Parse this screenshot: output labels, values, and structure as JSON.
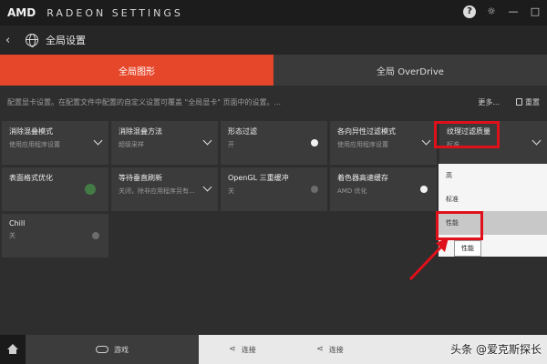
{
  "titlebar": {
    "brand": "AMD",
    "app_title": "RADEON SETTINGS",
    "help": "?",
    "settings": "☼",
    "minimize": "—",
    "maximize": "□"
  },
  "nav": {
    "back": "‹",
    "title": "全局设置"
  },
  "tabs": [
    {
      "label": "全局图形",
      "active": true
    },
    {
      "label": "全局 OverDrive",
      "active": false
    }
  ],
  "description": {
    "text": "配置显卡设置。在配置文件中配置的自定义设置可覆盖 \"全局显卡\" 页面中的设置。...",
    "more": "更多...",
    "reset": "重置"
  },
  "tiles": [
    {
      "label": "消除混叠模式",
      "value": "使用应用程序设置",
      "control": "chevron"
    },
    {
      "label": "消除混叠方法",
      "value": "超级采样",
      "control": "chevron"
    },
    {
      "label": "形态过滤",
      "value": "开",
      "control": "toggle-on"
    },
    {
      "label": "各向异性过滤模式",
      "value": "使用应用程序设置",
      "control": "chevron"
    },
    {
      "label": "纹理过滤质量",
      "value": "标准",
      "control": "chevron"
    },
    {
      "label": "表面格式优化",
      "value": "",
      "control": "toggle-green"
    },
    {
      "label": "等待垂直刷新",
      "value": "关闭，除非应用程序另有...",
      "control": "chevron"
    },
    {
      "label": "OpenGL 三重缓冲",
      "value": "关",
      "control": "toggle-off"
    },
    {
      "label": "着色器高速缓存",
      "value": "AMD 优化",
      "control": "toggle-on"
    },
    {
      "label": "Chill",
      "value": "关",
      "control": "toggle-off"
    }
  ],
  "dropdown": {
    "options": [
      "高",
      "标准",
      "性能"
    ],
    "selected": "性能",
    "tooltip": "性能"
  },
  "bottom_bar": {
    "games": "游戏",
    "connect_1": "连接",
    "connect_2": "连接"
  },
  "watermark": "头条 @爱克斯探长",
  "colors": {
    "accent": "#e6462a",
    "highlight": "#e0101a"
  }
}
